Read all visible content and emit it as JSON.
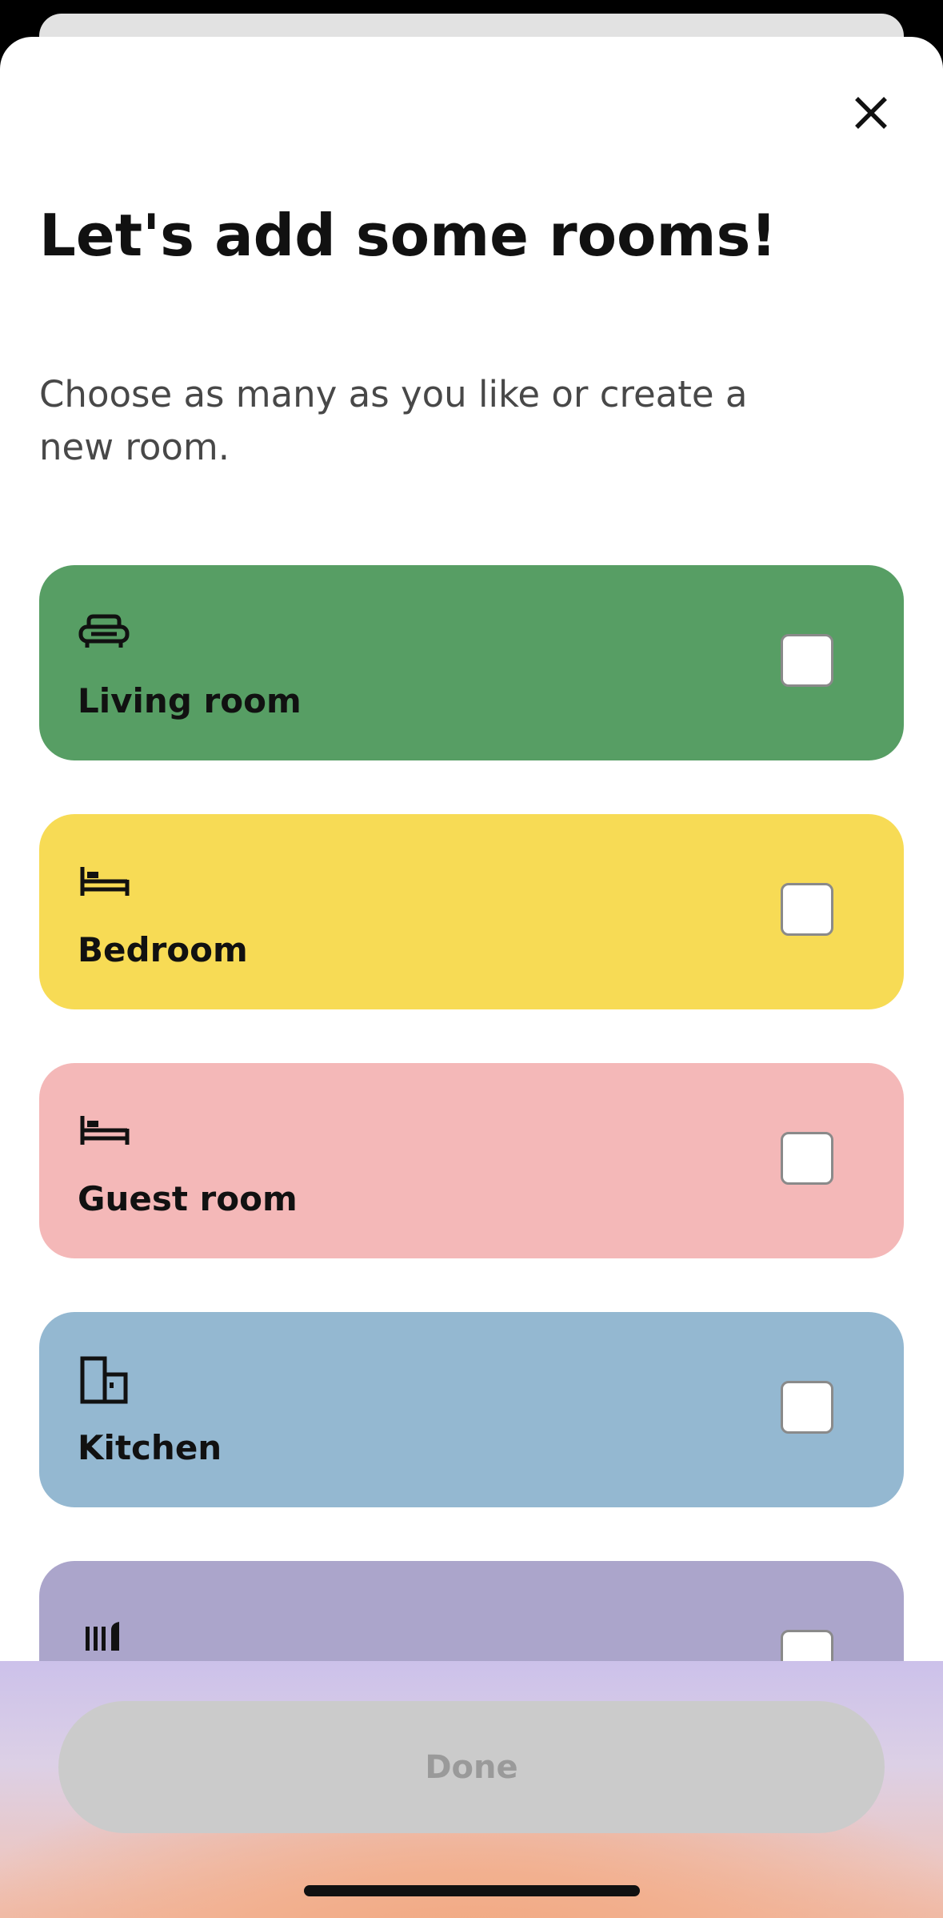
{
  "header": {
    "title": "Let's add some rooms!",
    "subtitle": "Choose as many as you like or create a new room.",
    "close_icon": "close-icon"
  },
  "rooms": [
    {
      "label": "Living room",
      "icon": "sofa-icon",
      "color": "#579e64",
      "checked": false
    },
    {
      "label": "Bedroom",
      "icon": "bed-icon",
      "color": "#f7db55",
      "checked": false
    },
    {
      "label": "Guest room",
      "icon": "bed-icon",
      "color": "#f4b8b8",
      "checked": false
    },
    {
      "label": "Kitchen",
      "icon": "kitchen-cabinet-icon",
      "color": "#94b8d1",
      "checked": false
    },
    {
      "label": "",
      "icon": "shelf-icon",
      "color": "#aba5cb",
      "checked": false
    }
  ],
  "footer": {
    "done_label": "Done",
    "done_enabled": false,
    "done_bg": "#cbcbcb",
    "done_text_color": "#9a9a9a"
  }
}
